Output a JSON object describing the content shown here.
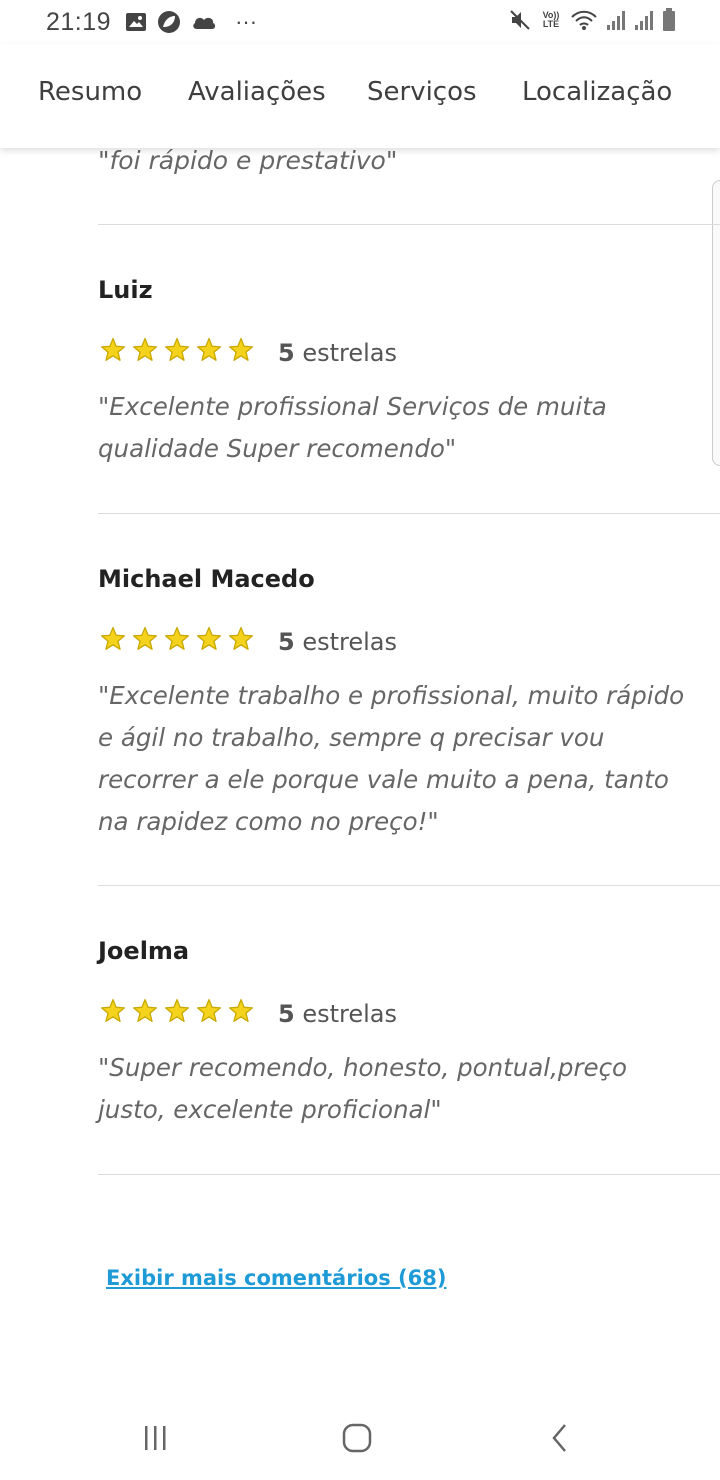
{
  "status_bar": {
    "time": "21:19",
    "left_icons": [
      "image-icon",
      "leaf-icon",
      "cloud-icon",
      "more-dots-icon"
    ],
    "right_icons": [
      "mute-icon",
      "volte-icon",
      "wifi-icon",
      "signal-icon",
      "signal-icon",
      "battery-icon"
    ],
    "volte_text": "Vo)) LTE",
    "more_dots": "···"
  },
  "tabs": [
    {
      "label": "Resumo"
    },
    {
      "label": "Avaliações"
    },
    {
      "label": "Serviços"
    },
    {
      "label": "Localização"
    }
  ],
  "partial_review": {
    "text": "\"foi rápido e prestativo\""
  },
  "reviews": [
    {
      "name": "Luiz",
      "stars": 5,
      "rating_number": "5",
      "rating_word": "estrelas",
      "text": "\"Excelente profissional Serviços de muita qualidade Super recomendo\""
    },
    {
      "name": "Michael Macedo",
      "stars": 5,
      "rating_number": "5",
      "rating_word": "estrelas",
      "text": "\"Excelente trabalho e profissional, muito rápido e ágil no trabalho, sempre q precisar vou recorrer a ele porque vale muito a pena, tanto na rapidez como no preço!\""
    },
    {
      "name": "Joelma",
      "stars": 5,
      "rating_number": "5",
      "rating_word": "estrelas",
      "text": "\"Super recomendo, honesto, pontual,preço justo, excelente proficional\""
    }
  ],
  "more_comments_link": "Exibir mais comentários (68)",
  "colors": {
    "star": "#f5d31c",
    "star_outline": "#c9a800",
    "link": "#1e9bd7",
    "divider": "#dcdcdc"
  },
  "nav_bar": {
    "icons": [
      "recent-apps-icon",
      "home-icon",
      "back-icon"
    ]
  }
}
